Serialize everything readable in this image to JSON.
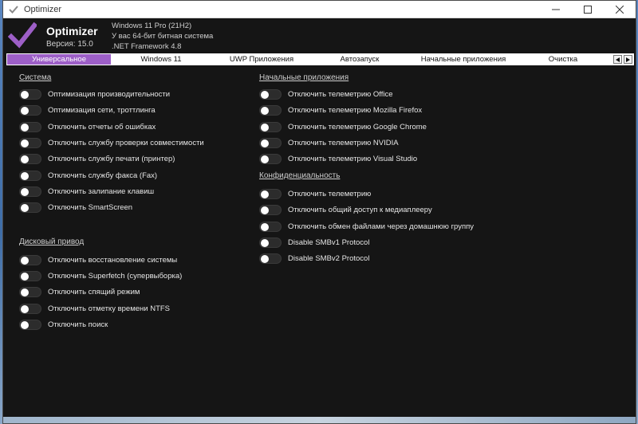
{
  "window": {
    "title": "Optimizer"
  },
  "header": {
    "app_name": "Optimizer",
    "version": "Версия: 15.0",
    "os": "Windows 11 Pro (21H2)",
    "arch": "У вас 64-бит битная система",
    "framework": ".NET Framework 4.8"
  },
  "tabs": [
    {
      "label": "Универсальное",
      "active": true
    },
    {
      "label": "Windows 11",
      "active": false
    },
    {
      "label": "UWP Приложения",
      "active": false
    },
    {
      "label": "Автозапуск",
      "active": false
    },
    {
      "label": "Начальные приложения",
      "active": false
    },
    {
      "label": "Очистка",
      "active": false
    }
  ],
  "sections": {
    "system": {
      "title": "Система",
      "items": [
        "Оптимизация производительности",
        "Оптимизация сети, троттлинга",
        "Отключить отчеты об ошибках",
        "Отключить службу проверки совместимости",
        "Отключить службу печати (принтер)",
        "Отключить службу факса (Fax)",
        "Отключить залипание клавиш",
        "Отключить SmartScreen"
      ]
    },
    "disk": {
      "title": "Дисковый привод",
      "items": [
        "Отключить восстановление системы",
        "Отключить Superfetch (супервыборка)",
        "Отключить спящий режим",
        "Отключить отметку времени NTFS",
        "Отключить поиск"
      ]
    },
    "startup": {
      "title": "Начальные приложения",
      "items": [
        "Отключить телеметрию Office",
        "Отключить телеметрию Mozilla Firefox",
        "Отключить телеметрию Google Chrome",
        "Отключить телеметрию NVIDIA",
        "Отключить телеметрию Visual Studio"
      ]
    },
    "privacy": {
      "title": "Конфиденциальность",
      "items": [
        "Отключить телеметрию",
        "Отключить общий доступ к медиаплееру",
        "Отключить обмен файлами через домашнюю группу",
        "Disable SMBv1 Protocol",
        "Disable SMBv2 Protocol"
      ]
    }
  },
  "colors": {
    "accent": "#9d5fc7",
    "background": "#151515",
    "text": "#e6e6e6"
  }
}
